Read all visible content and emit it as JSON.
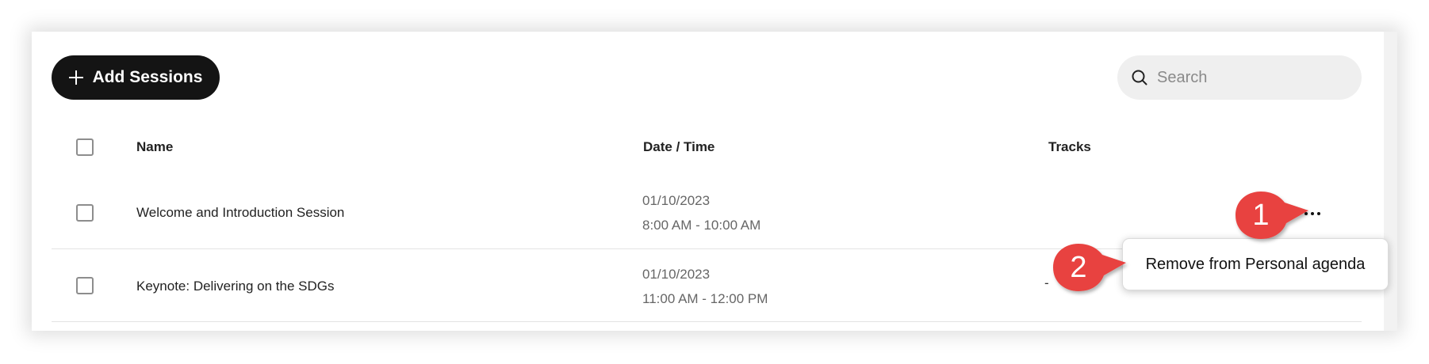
{
  "toolbar": {
    "add_label": "Add Sessions",
    "search_placeholder": "Search"
  },
  "table": {
    "headers": {
      "name": "Name",
      "datetime": "Date / Time",
      "tracks": "Tracks"
    },
    "rows": [
      {
        "name": "Welcome and Introduction Session",
        "date": "01/10/2023",
        "time": "8:00 AM - 10:00 AM",
        "tracks": ""
      },
      {
        "name": "Keynote: Delivering on the SDGs",
        "date": "01/10/2023",
        "time": "11:00 AM - 12:00 PM",
        "tracks": "-"
      }
    ]
  },
  "context_menu": {
    "items": [
      "Remove from Personal agenda"
    ]
  },
  "callouts": {
    "step1": "1",
    "step2": "2"
  },
  "colors": {
    "button_bg": "#141414",
    "callout_red": "#e8433f",
    "search_bg": "#efefef"
  },
  "icons": {
    "add": "plus-icon",
    "search": "search-icon",
    "row_actions": "more-horizontal-icon"
  }
}
